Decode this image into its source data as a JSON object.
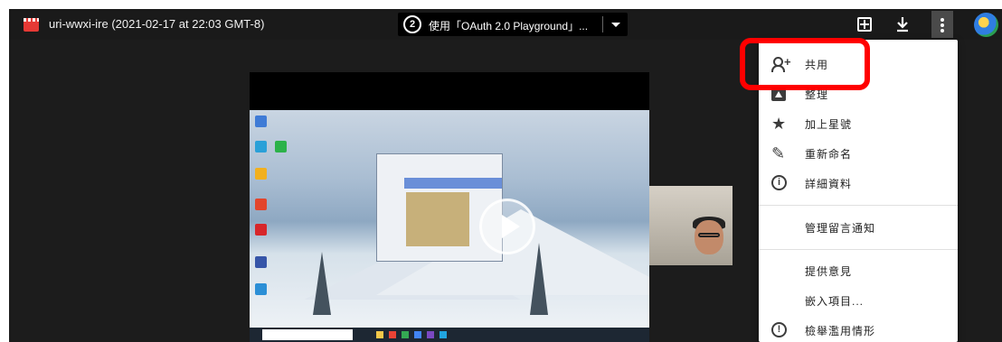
{
  "header": {
    "file_title": "uri-wwxi-ire (2021-02-17 at 22:03 GMT-8)",
    "playlist_index": "2",
    "playlist_title": "使用「OAuth 2.0 Playground」..."
  },
  "menu": {
    "items": [
      {
        "label": "共用",
        "icon": "person-add-icon"
      },
      {
        "label": "整理",
        "icon": "drive-icon"
      },
      {
        "label": "加上星號",
        "icon": "star-icon"
      },
      {
        "label": "重新命名",
        "icon": "pencil-icon"
      },
      {
        "label": "詳細資料",
        "icon": "info-icon"
      },
      {
        "label": "管理留言通知",
        "icon": ""
      },
      {
        "label": "提供意見",
        "icon": ""
      },
      {
        "label": "嵌入項目...",
        "icon": ""
      },
      {
        "label": "檢舉濫用情形",
        "icon": "report-icon"
      }
    ]
  },
  "colors": {
    "highlight": "#ff0000",
    "toolbar_bg": "#1a1a1a",
    "viewer_bg": "#1c1c1c"
  }
}
